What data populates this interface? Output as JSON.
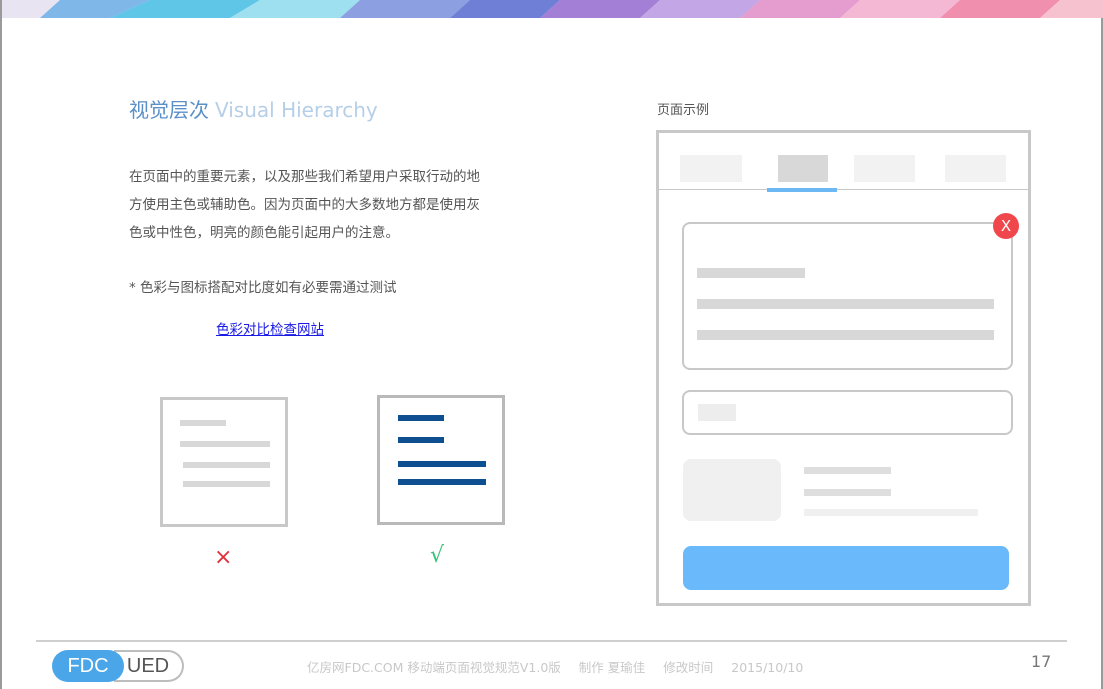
{
  "title": {
    "cn": "视觉层次",
    "en": "Visual Hierarchy"
  },
  "body": {
    "line1": "在页面中的重要元素，以及那些我们希望用户采取行动的地",
    "line2": "方使用主色或辅助色。因为页面中的大多数地方都是使用灰",
    "line3": "色或中性色，明亮的颜色能引起用户的注意。"
  },
  "note": "*  色彩与图标搭配对比度如有必要需通过测试",
  "link": "色彩对比检查网站",
  "marks": {
    "wrong": "×",
    "right": "√"
  },
  "example": {
    "label": "页面示例",
    "close_glyph": "X"
  },
  "footer": {
    "logo_left": "FDC",
    "logo_right": "UED",
    "site": "亿房网FDC.COM 移动端页面视觉规范V1.0版",
    "author": "制作 夏瑜佳",
    "modified": "修改时间",
    "date": "2015/10/10",
    "page": "17"
  },
  "colors": {
    "title_cn": "#5a8fc8",
    "title_en": "#b5cfe8",
    "accent_blue": "#69b9fb",
    "dark_blue": "#0e4f91",
    "error_red": "#f0474c",
    "ok_green": "#3ac27a"
  },
  "icons": {
    "wrong": "cross-icon",
    "right": "check-icon",
    "close": "close-icon"
  }
}
